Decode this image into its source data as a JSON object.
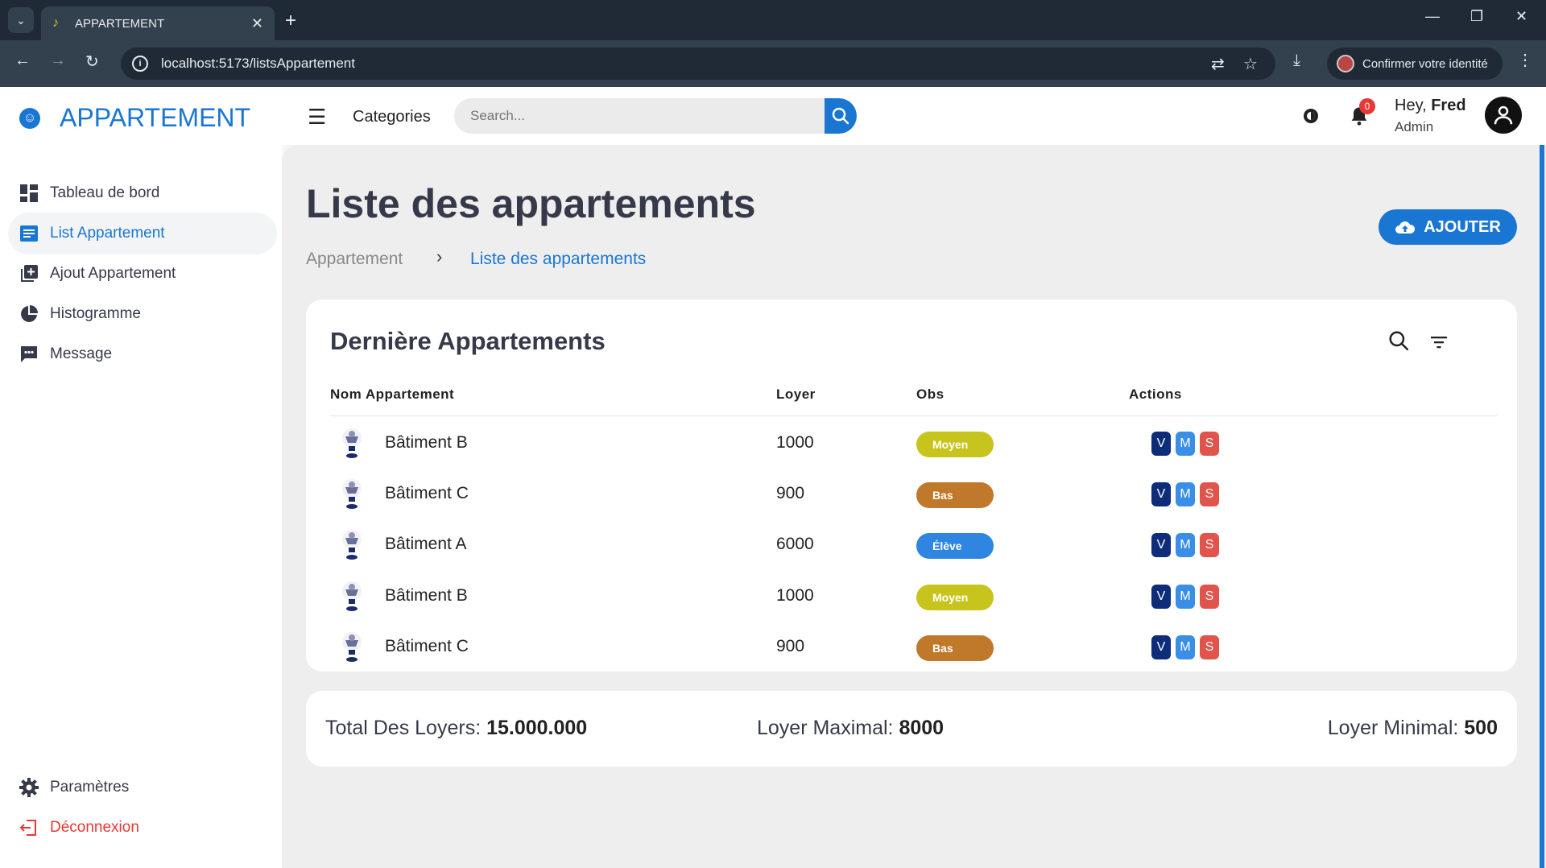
{
  "browser": {
    "tab_title": "APPARTEMENT",
    "url": "localhost:5173/listsAppartement",
    "confirm_identity": "Confirmer votre identité"
  },
  "topbar": {
    "brand": "APPARTEMENT",
    "categories_label": "Categories",
    "search_placeholder": "Search...",
    "notification_count": "0",
    "greeting": "Hey,",
    "user_name": "Fred",
    "user_role": "Admin"
  },
  "sidebar": {
    "items": [
      {
        "label": "Tableau de bord",
        "icon": "dashboard-icon"
      },
      {
        "label": "List Appartement",
        "icon": "list-icon",
        "active": true
      },
      {
        "label": "Ajout Appartement",
        "icon": "add-library-icon"
      },
      {
        "label": "Histogramme",
        "icon": "pie-chart-icon"
      },
      {
        "label": "Message",
        "icon": "message-icon"
      }
    ],
    "settings_label": "Paramètres",
    "logout_label": "Déconnexion"
  },
  "main": {
    "page_title": "Liste des appartements",
    "breadcrumb": [
      "Appartement",
      "Liste des appartements"
    ],
    "add_button": "AJOUTER",
    "card_title": "Dernière Appartements",
    "columns": [
      "Nom Appartement",
      "Loyer",
      "Obs",
      "Actions"
    ],
    "rows": [
      {
        "name": "Bâtiment B",
        "loyer": "1000",
        "obs": "Moyen"
      },
      {
        "name": "Bâtiment C",
        "loyer": "900",
        "obs": "Bas"
      },
      {
        "name": "Bâtiment A",
        "loyer": "6000",
        "obs": "Élève"
      },
      {
        "name": "Bâtiment B",
        "loyer": "1000",
        "obs": "Moyen"
      },
      {
        "name": "Bâtiment C",
        "loyer": "900",
        "obs": "Bas"
      }
    ],
    "actions": [
      "V",
      "M",
      "S"
    ],
    "obs_colors": {
      "Moyen": "#c8c41e",
      "Bas": "#c0782a",
      "Élève": "#2f86e0"
    },
    "action_colors": {
      "V": "#0d2c7a",
      "M": "#3a8ee6",
      "S": "#e0544b"
    },
    "totals": {
      "total_label": "Total Des Loyers:",
      "total_value": "15.000.000",
      "max_label": "Loyer Maximal:",
      "max_value": "8000",
      "min_label": "Loyer Minimal:",
      "min_value": "500"
    }
  },
  "colors": {
    "accent": "#1976d2",
    "danger": "#e53935"
  }
}
